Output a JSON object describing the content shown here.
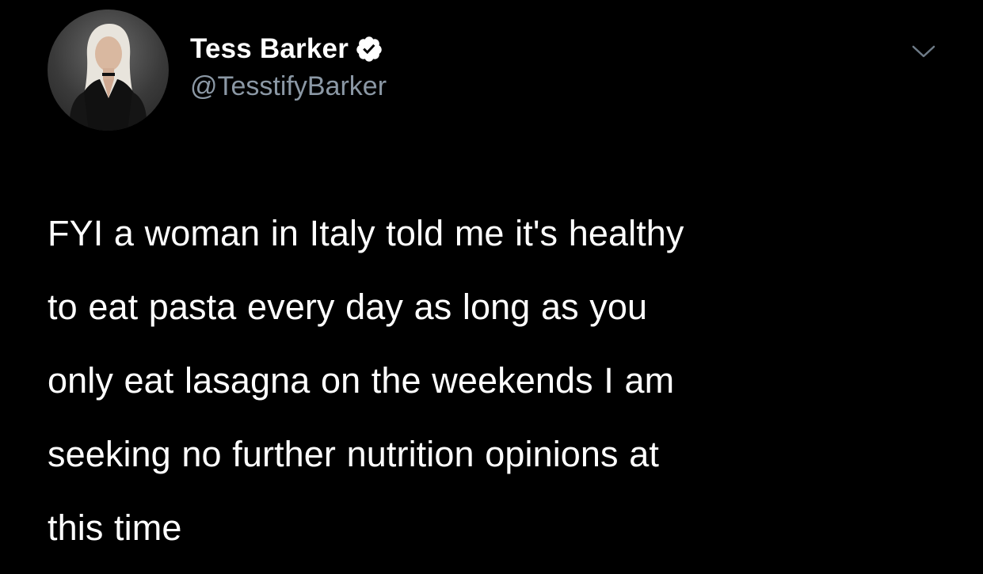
{
  "tweet": {
    "author": {
      "display_name": "Tess Barker",
      "handle": "@TesstifyBarker",
      "verified": true,
      "verified_icon": "verified-badge-icon",
      "avatar_icon": "profile-photo"
    },
    "menu_icon": "chevron-down-icon",
    "text_lines": [
      "FYI a woman in Italy told me it's healthy",
      "to eat pasta every day as long as you",
      "only eat lasagna on the weekends I am",
      "seeking no further nutrition opinions at",
      "this time"
    ]
  },
  "colors": {
    "background": "#000000",
    "text": "#ffffff",
    "secondary_text": "#8b98a5"
  }
}
